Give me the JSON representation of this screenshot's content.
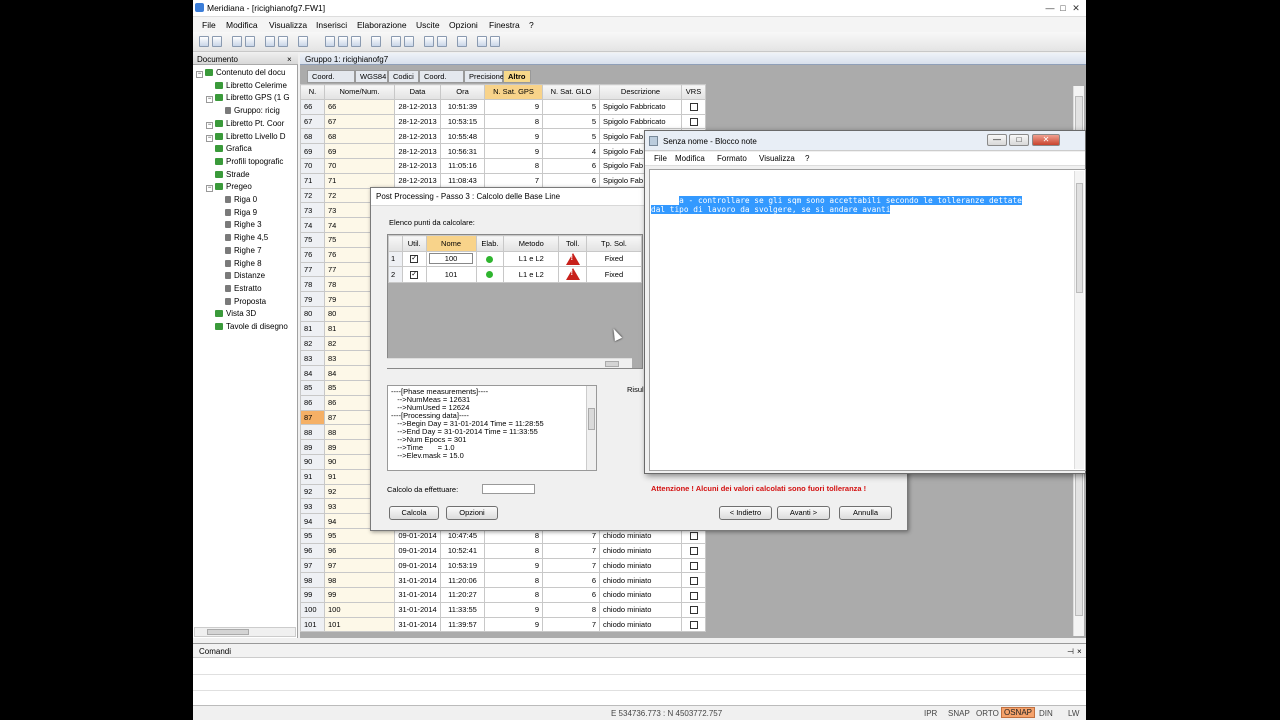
{
  "window": {
    "title": "Meridiana - [ricighianofg7.FW1]",
    "min": "—",
    "max": "□",
    "close": "✕"
  },
  "menu": [
    "File",
    "Modifica",
    "Visualizza",
    "Inserisci",
    "Elaborazione",
    "Uscite",
    "Opzioni",
    "Finestra",
    "?"
  ],
  "left_panel": {
    "title": "Documento",
    "close": "×",
    "nodes": [
      {
        "label": "Contenuto del docu",
        "indent": 0
      },
      {
        "label": "Libretto Celerime",
        "indent": 1
      },
      {
        "label": "Libretto GPS (1 G",
        "indent": 1
      },
      {
        "label": "Gruppo: ricig",
        "indent": 2
      },
      {
        "label": "Libretto Pt. Coor",
        "indent": 1
      },
      {
        "label": "Libretto Livello D",
        "indent": 1
      },
      {
        "label": "Grafica",
        "indent": 1
      },
      {
        "label": "Profili topografic",
        "indent": 1
      },
      {
        "label": "Strade",
        "indent": 1
      },
      {
        "label": "Pregeo",
        "indent": 1
      },
      {
        "label": "Riga 0",
        "indent": 2
      },
      {
        "label": "Riga 9",
        "indent": 2
      },
      {
        "label": "Righe 3",
        "indent": 2
      },
      {
        "label": "Righe 4,5",
        "indent": 2
      },
      {
        "label": "Righe 7",
        "indent": 2
      },
      {
        "label": "Righe 8",
        "indent": 2
      },
      {
        "label": "Distanze",
        "indent": 2
      },
      {
        "label": "Estratto",
        "indent": 2
      },
      {
        "label": "Proposta",
        "indent": 2
      },
      {
        "label": "Vista 3D",
        "indent": 1
      },
      {
        "label": "Tavole di disegno",
        "indent": 1
      }
    ]
  },
  "grid": {
    "group_title": "Gruppo 1: ricighianofg7",
    "tabs": [
      "Coord. GPS",
      "WGS84",
      "Codici",
      "Coord. Pla.",
      "Precisione",
      "Altro"
    ],
    "active_tab": "Altro",
    "columns": [
      "N.",
      "Nome/Num.",
      "Data",
      "Ora",
      "N. Sat. GPS",
      "N. Sat. GLO",
      "Descrizione",
      "VRS"
    ],
    "rows": [
      [
        "66",
        "66",
        "28-12-2013",
        "10:51:39",
        "9",
        "5",
        "Spigolo Fabbricato"
      ],
      [
        "67",
        "67",
        "28-12-2013",
        "10:53:15",
        "8",
        "5",
        "Spigolo Fabbricato"
      ],
      [
        "68",
        "68",
        "28-12-2013",
        "10:55:48",
        "9",
        "5",
        "Spigolo Fab"
      ],
      [
        "69",
        "69",
        "28-12-2013",
        "10:56:31",
        "9",
        "4",
        "Spigolo Fab"
      ],
      [
        "70",
        "70",
        "28-12-2013",
        "11:05:16",
        "8",
        "6",
        "Spigolo Fab"
      ],
      [
        "71",
        "71",
        "28-12-2013",
        "11:08:43",
        "7",
        "6",
        "Spigolo Fab"
      ],
      [
        "72",
        "72",
        "",
        "",
        "",
        "",
        ""
      ],
      [
        "73",
        "73",
        "",
        "",
        "",
        "",
        ""
      ],
      [
        "74",
        "74",
        "",
        "",
        "",
        "",
        ""
      ],
      [
        "75",
        "75",
        "",
        "",
        "",
        "",
        ""
      ],
      [
        "76",
        "76",
        "",
        "",
        "",
        "",
        ""
      ],
      [
        "77",
        "77",
        "",
        "",
        "",
        "",
        ""
      ],
      [
        "78",
        "78",
        "",
        "",
        "",
        "",
        ""
      ],
      [
        "79",
        "79",
        "",
        "",
        "",
        "",
        ""
      ],
      [
        "80",
        "80",
        "",
        "",
        "",
        "",
        ""
      ],
      [
        "81",
        "81",
        "",
        "",
        "",
        "",
        ""
      ],
      [
        "82",
        "82",
        "",
        "",
        "",
        "",
        ""
      ],
      [
        "83",
        "83",
        "",
        "",
        "",
        "",
        ""
      ],
      [
        "84",
        "84",
        "",
        "",
        "",
        "",
        ""
      ],
      [
        "85",
        "85",
        "",
        "",
        "",
        "",
        ""
      ],
      [
        "86",
        "86",
        "",
        "",
        "",
        "",
        ""
      ],
      [
        "87",
        "87",
        "",
        "",
        "",
        "",
        ""
      ],
      [
        "88",
        "88",
        "",
        "",
        "",
        "",
        ""
      ],
      [
        "89",
        "89",
        "",
        "",
        "",
        "",
        ""
      ],
      [
        "90",
        "90",
        "",
        "",
        "",
        "",
        ""
      ],
      [
        "91",
        "91",
        "",
        "",
        "",
        "",
        ""
      ],
      [
        "92",
        "92",
        "",
        "",
        "",
        "",
        ""
      ],
      [
        "93",
        "93",
        "",
        "",
        "",
        "",
        ""
      ],
      [
        "94",
        "94",
        "",
        "",
        "",
        "",
        ""
      ],
      [
        "95",
        "95",
        "09-01-2014",
        "10:47:45",
        "8",
        "7",
        "chiodo miniato"
      ],
      [
        "96",
        "96",
        "09-01-2014",
        "10:52:41",
        "8",
        "7",
        "chiodo miniato"
      ],
      [
        "97",
        "97",
        "09-01-2014",
        "10:53:19",
        "9",
        "7",
        "chiodo miniato"
      ],
      [
        "98",
        "98",
        "31-01-2014",
        "11:20:06",
        "8",
        "6",
        "chiodo miniato"
      ],
      [
        "99",
        "99",
        "31-01-2014",
        "11:20:27",
        "8",
        "6",
        "chiodo miniato"
      ],
      [
        "100",
        "100",
        "31-01-2014",
        "11:33:55",
        "9",
        "8",
        "chiodo miniato"
      ],
      [
        "101",
        "101",
        "31-01-2014",
        "11:39:57",
        "9",
        "7",
        "chiodo miniato"
      ]
    ],
    "highlight_row": "87"
  },
  "commands": {
    "title": "Comandi",
    "pin": "⊣",
    "close": "×"
  },
  "status": {
    "coords": "E 534736.773 : N 4503772.757",
    "items": [
      "IPR",
      "SNAP",
      "ORTO",
      "OSNAP",
      "DIN",
      "LW"
    ],
    "active": "OSNAP"
  },
  "dialog": {
    "title": "Post Processing - Passo 3 : Calcolo delle Base Line",
    "list_label": "Elenco punti da calcolare:",
    "columns": [
      "Util.",
      "Nome",
      "Elab.",
      "Metodo",
      "Toll.",
      "Tp. Sol."
    ],
    "rows": [
      {
        "n": "1",
        "name": "100",
        "method": "L1 e L2",
        "sol": "Fixed"
      },
      {
        "n": "2",
        "name": "101",
        "method": "L1 e L2",
        "sol": "Fixed"
      }
    ],
    "results_label": "Risul",
    "log": [
      "----[Phase measurements]----",
      "   -->NumMeas = 12631",
      "   -->NumUsed = 12624",
      "----[Processing data]----",
      "   -->Begin Day = 31-01-2014 Time = 11:28:55",
      "   -->End Day = 31-01-2014 Time = 11:33:55",
      "   -->Num Epocs = 301",
      "   -->Time       = 1.0",
      "   -->Elev.mask = 15.0"
    ],
    "calc_label": "Calcolo da effettuare:",
    "warning": "Attenzione ! Alcuni dei valori calcolati sono fuori tolleranza !",
    "buttons": {
      "calcola": "Calcola",
      "opzioni": "Opzioni",
      "indietro": "< Indietro",
      "avanti": "Avanti >",
      "annulla": "Annulla"
    }
  },
  "notepad": {
    "title": "Senza nome - Blocco note",
    "menu": [
      "File",
      "Modifica",
      "Formato",
      "Visualizza",
      "?"
    ],
    "lines": [
      "a - controllare se gli sqm sono accettabili secondo le tolleranze dettate",
      "dal tipo di lavoro da svolgere, se si andare avanti"
    ],
    "min": "—",
    "max": "□",
    "close": "✕"
  }
}
